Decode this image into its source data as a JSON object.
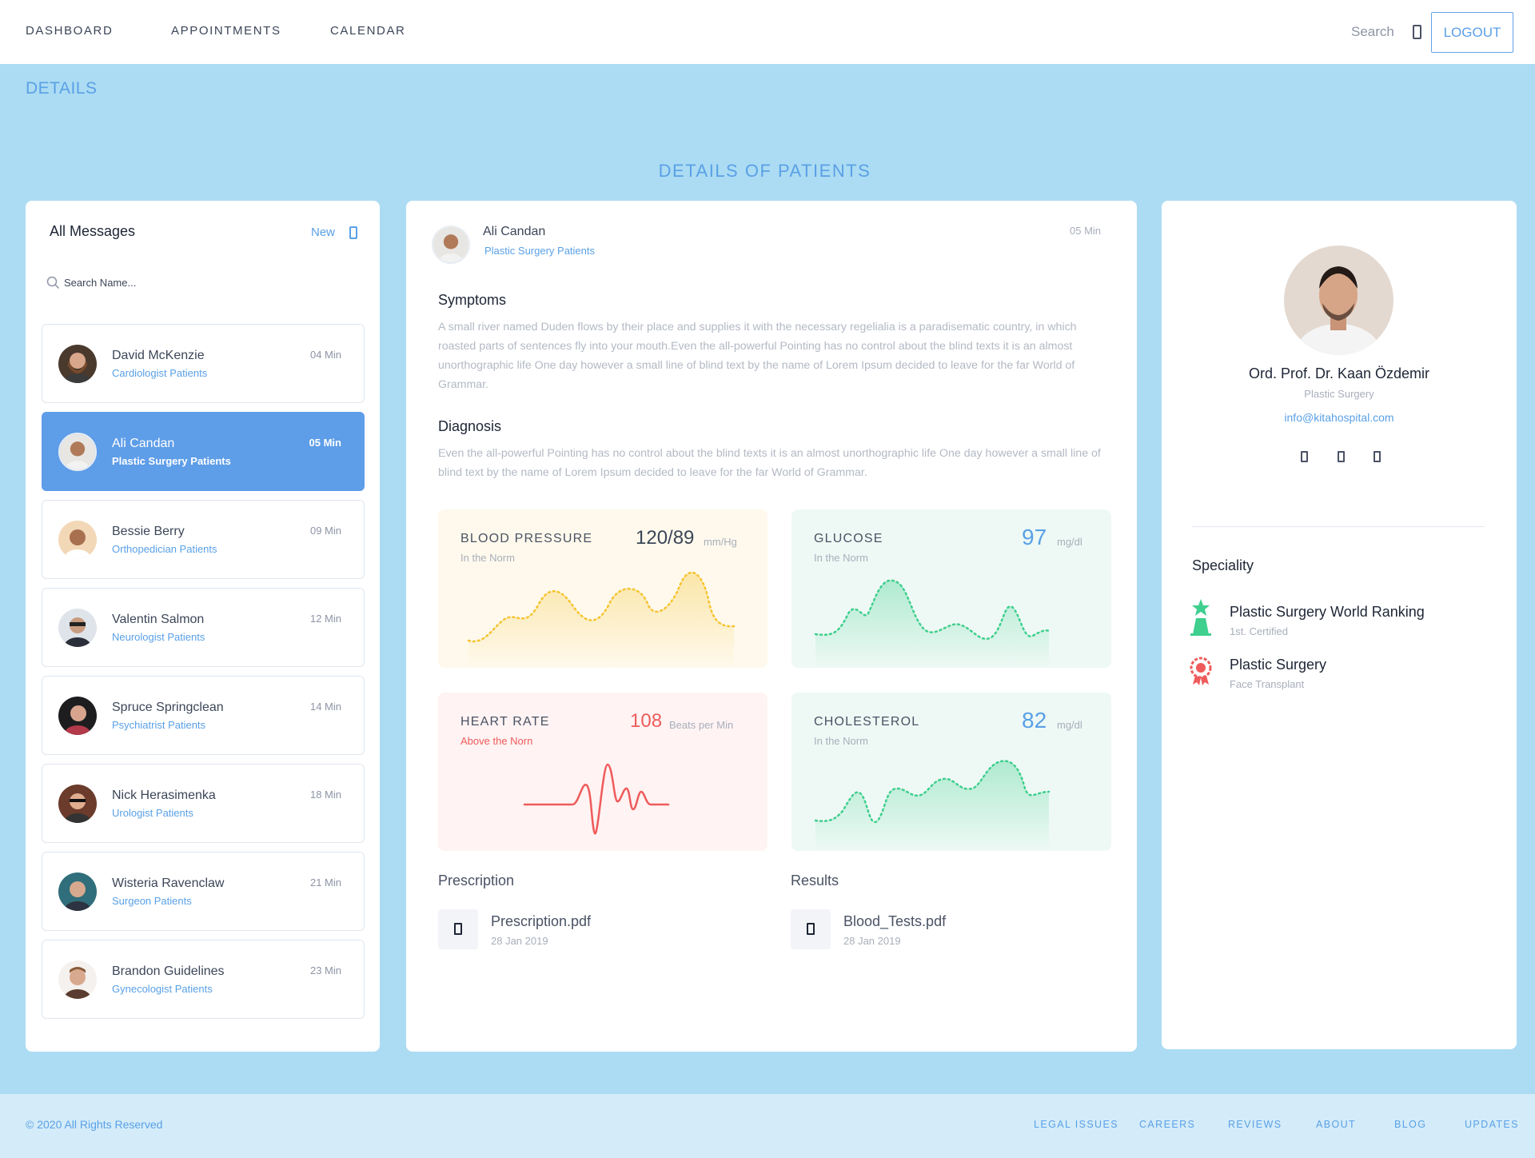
{
  "nav": {
    "links": [
      "DASHBOARD",
      "APPOINTMENTS",
      "CALENDAR"
    ],
    "search_label": "Search",
    "logout_label": "LOGOUT"
  },
  "breadcrumb": "DETAILS",
  "page_title": "DETAILS OF PATIENTS",
  "messages": {
    "title": "All Messages",
    "new_label": "New",
    "search_placeholder": "Search Name...",
    "patients": [
      {
        "name": "David McKenzie",
        "group": "Cardiologist Patients",
        "time": "04 Min"
      },
      {
        "name": "Ali Candan",
        "group": "Plastic Surgery Patients",
        "time": "05 Min"
      },
      {
        "name": "Bessie Berry",
        "group": "Orthopedician Patients",
        "time": "09 Min"
      },
      {
        "name": "Valentin Salmon",
        "group": "Neurologist Patients",
        "time": "12 Min"
      },
      {
        "name": "Spruce Springclean",
        "group": "Psychiatrist Patients",
        "time": "14 Min"
      },
      {
        "name": "Nick Herasimenka",
        "group": "Urologist Patients",
        "time": "18 Min"
      },
      {
        "name": "Wisteria Ravenclaw",
        "group": "Surgeon Patients",
        "time": "21 Min"
      },
      {
        "name": "Brandon Guidelines",
        "group": "Gynecologist Patients",
        "time": "23 Min"
      }
    ]
  },
  "details": {
    "name": "Ali Candan",
    "group": "Plastic Surgery Patients",
    "time": "05 Min",
    "symptoms_title": "Symptoms",
    "symptoms_text": "A small river named Duden flows by their place and supplies it with the necessary regelialia is a paradisematic country, in which roasted parts of sentences fly into your mouth.Even the all-powerful Pointing has no control about the blind texts it is an almost unorthographic life One day however a small line of blind text by the name of Lorem Ipsum decided to leave for the far World of Grammar.",
    "diagnosis_title": "Diagnosis",
    "diagnosis_text": "Even the all-powerful Pointing has no control about the blind texts it is an almost unorthographic life One day however a small line of blind text by the name of Lorem Ipsum decided to leave for the far World of Grammar.",
    "metrics": {
      "blood_pressure": {
        "title": "BLOOD PRESSURE",
        "status": "In the Norm",
        "value": "120/89",
        "unit": "mm/Hg",
        "color": "#f5c430",
        "bg": "#fef9ec"
      },
      "glucose": {
        "title": "GLUCOSE",
        "status": "In the Norm",
        "value": "97",
        "unit": "mg/dl",
        "color": "#3fcf8e",
        "bg": "#eef9f5"
      },
      "heart_rate": {
        "title": "HEART RATE",
        "status": "Above the Norn",
        "value": "108",
        "unit": "Beats per Min",
        "color": "#ef5b5b",
        "bg": "#fff3f3"
      },
      "cholesterol": {
        "title": "CHOLESTEROL",
        "status": "In the Norm",
        "value": "82",
        "unit": "mg/dl",
        "color": "#3fcf8e",
        "bg": "#eef9f5"
      }
    },
    "prescription": {
      "heading": "Prescription",
      "file": "Prescription.pdf",
      "date": "28 Jan 2019"
    },
    "results": {
      "heading": "Results",
      "file": "Blood_Tests.pdf",
      "date": "28 Jan 2019"
    }
  },
  "doctor": {
    "name": "Ord. Prof. Dr. Kaan Özdemir",
    "specialty": "Plastic Surgery",
    "email": "info@kitahospital.com",
    "speciality_title": "Speciality",
    "items": [
      {
        "title": "Plastic Surgery World Ranking",
        "sub": "1st. Certified"
      },
      {
        "title": "Plastic Surgery",
        "sub": "Face Transplant"
      }
    ]
  },
  "footer": {
    "copyright": "© 2020 All Rights Reserved",
    "links": [
      "LEGAL ISSUES",
      "CAREERS",
      "REVIEWS",
      "ABOUT",
      "BLOG",
      "UPDATES"
    ]
  },
  "colors": {
    "accent": "#5aa0e6",
    "background": "#acdcf3",
    "active_item": "#5e9de8"
  }
}
